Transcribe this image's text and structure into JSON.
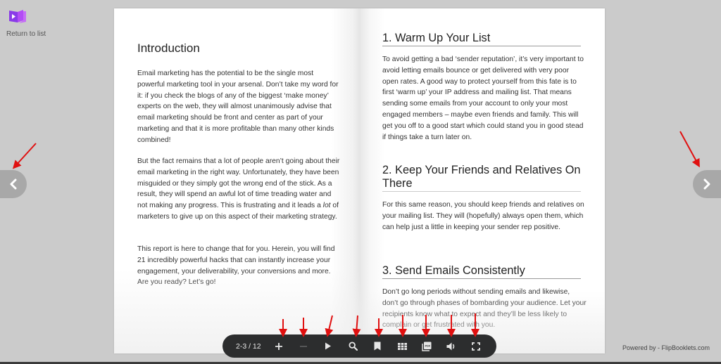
{
  "header": {
    "return_label": "Return to list",
    "logo_icon": "book-play-icon"
  },
  "toolbar": {
    "page_counter": "2-3 / 12",
    "buttons": [
      {
        "name": "zoom-in",
        "icon": "plus-icon"
      },
      {
        "name": "zoom-out",
        "icon": "minus-icon",
        "disabled": true
      },
      {
        "name": "autoplay",
        "icon": "play-icon"
      },
      {
        "name": "search",
        "icon": "search-icon"
      },
      {
        "name": "bookmark",
        "icon": "bookmark-icon"
      },
      {
        "name": "thumbnails",
        "icon": "grid-icon"
      },
      {
        "name": "download-pdf",
        "icon": "pdf-icon",
        "label": "PDF"
      },
      {
        "name": "sound",
        "icon": "volume-icon"
      },
      {
        "name": "fullscreen",
        "icon": "fullscreen-icon"
      }
    ]
  },
  "navigation": {
    "prev_icon": "chevron-left-icon",
    "next_icon": "chevron-right-icon"
  },
  "footer": {
    "powered_by": "Powered by - FlipBooklets.com"
  },
  "colors": {
    "background": "#cbcbcb",
    "toolbar": "#2c2d2e",
    "nav_button": "#a8a8a8",
    "logo_purple": "#9b3df0",
    "annotation_arrow": "#e01010"
  },
  "book": {
    "left_page": {
      "title": "Introduction",
      "paragraphs": [
        "Email marketing has the potential to be the single most powerful marketing tool in your arsenal. Don’t take my word for it: if you check the blogs of any of the biggest ‘make money’ experts on the web, they will almost unanimously advise that email marketing should be front and center as part of your marketing and that it is more profitable than many other kinds combined!",
        {
          "before": "But the fact remains that a lot of people aren’t going about their email marketing in the right way. Unfortunately, they have been misguided or they simply got the wrong end of the stick. As a result, they will spend an awful lot of time treading water and not making any progress. This is frustrating and it leads a ",
          "emphasis": "lot",
          "after": " of marketers to give up on this aspect of their marketing strategy."
        },
        "This report is here to change that for you. Herein, you will find 21 incredibly powerful hacks that can instantly increase your engagement, your deliverability, your conversions and more. Are you ready? Let’s go!"
      ]
    },
    "right_page": {
      "sections": [
        {
          "heading": "1. Warm Up Your List",
          "body": "To avoid getting a bad ‘sender reputation’, it’s very important to avoid letting emails bounce or get delivered with very poor open rates. A good way to protect yourself from this fate is to first ‘warm up’ your IP address and mailing list. That means sending some emails from your account to only your most engaged members – maybe even friends and family. This will get you off to a good start which could stand you in good stead if things take a turn later on."
        },
        {
          "heading": "2. Keep Your Friends and Relatives On There",
          "body": "For this same reason, you should keep friends and relatives on your mailing list. They will (hopefully) always open them, which can help just a little in keeping your sender rep positive."
        },
        {
          "heading": "3. Send Emails Consistently",
          "body": "Don’t go long periods without sending emails and likewise, don’t go through phases of bombarding your audience. Let your recipients know what to expect and they’ll be less likely to complain or get frustrated with you."
        }
      ]
    }
  }
}
